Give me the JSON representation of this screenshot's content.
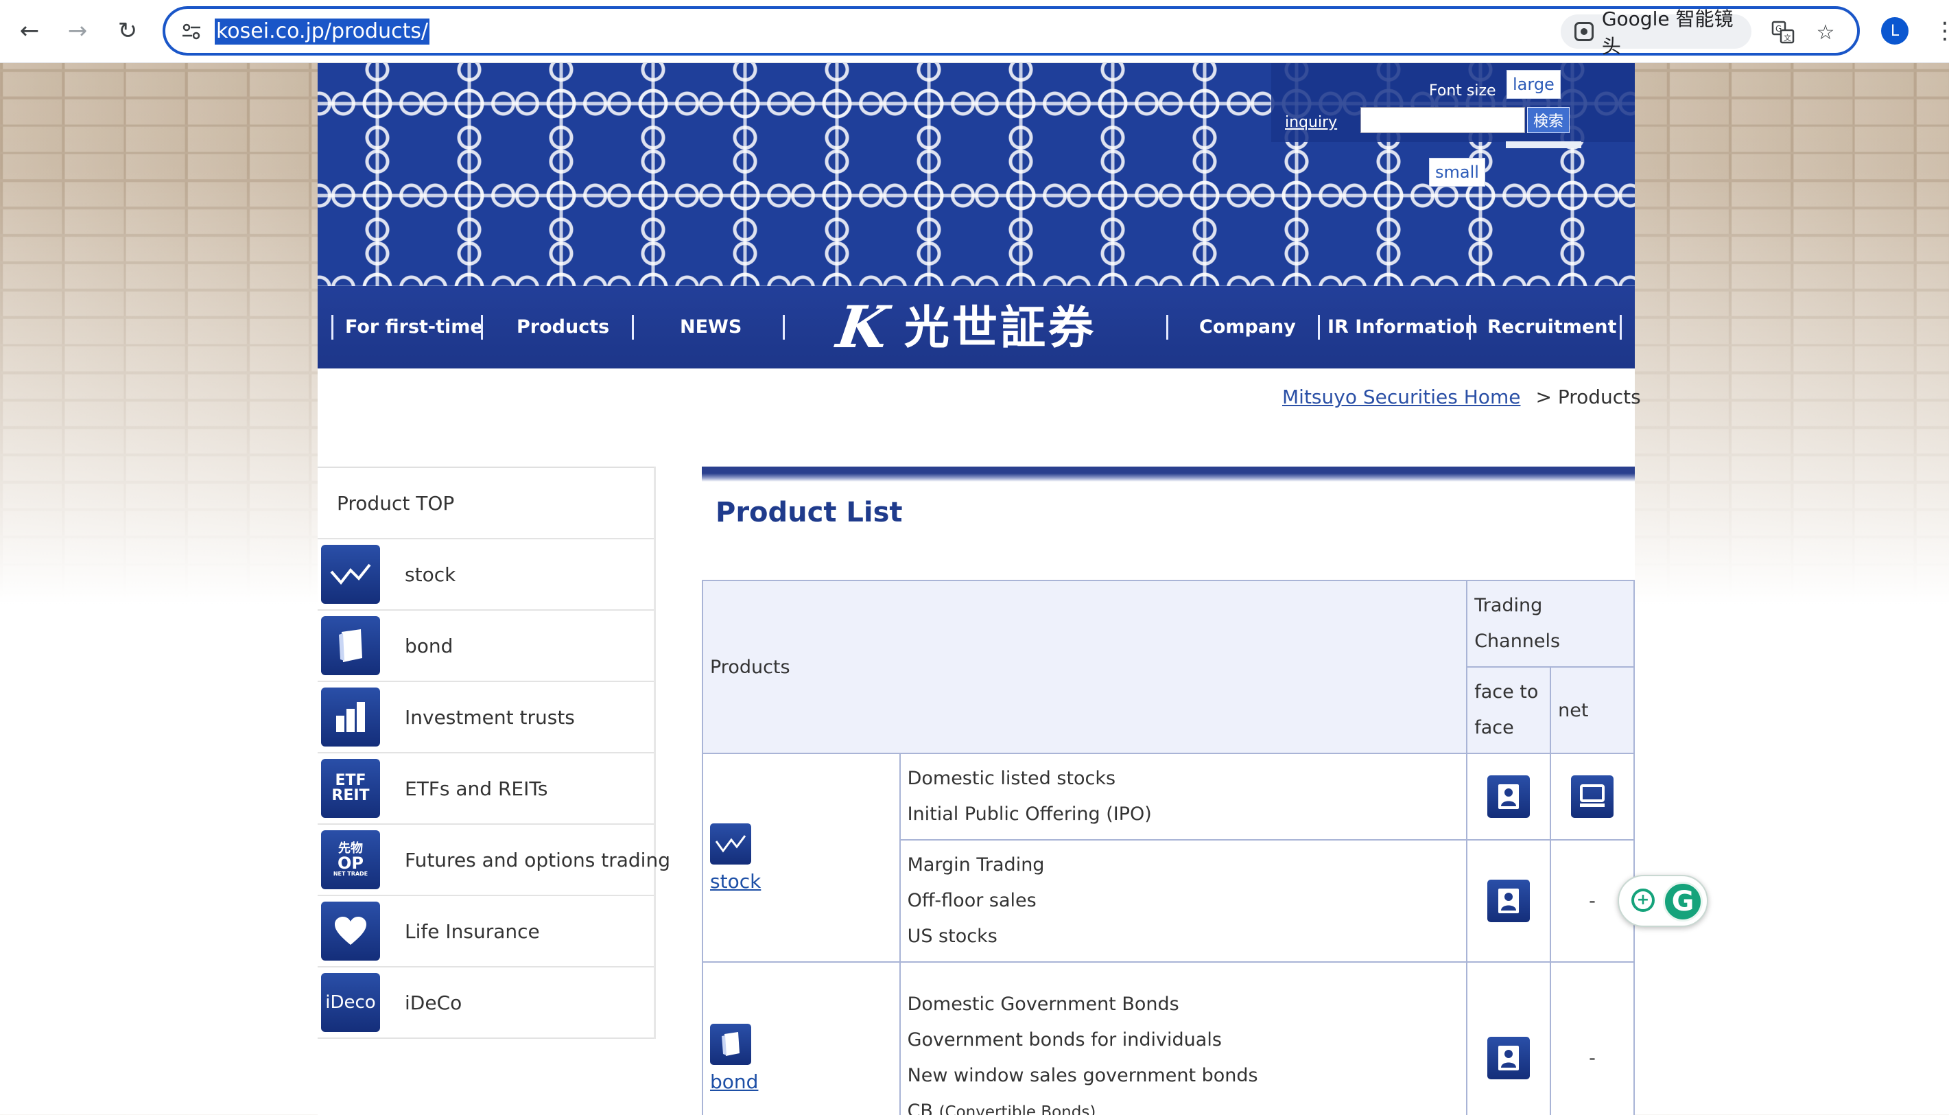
{
  "browser": {
    "url": "kosei.co.jp/products/",
    "lens_label": "Google 智能镜头",
    "avatar_letter": "L",
    "icons": {
      "back": "back-arrow-icon",
      "forward": "forward-arrow-icon",
      "reload": "reload-icon",
      "site_info": "site-info-icon",
      "translate": "translate-icon",
      "bookmark": "star-icon",
      "menu": "kebab-menu-icon"
    }
  },
  "header": {
    "font_size_label": "Font size",
    "font_large": "large",
    "font_small": "small",
    "inquiry": "inquiry",
    "search_button": "検索"
  },
  "nav": {
    "items": [
      "For first-time",
      "Products",
      "NEWS",
      "Company",
      "IR Information",
      "Recruitment"
    ],
    "logo_mark": "K",
    "logo_text": "光世証券"
  },
  "breadcrumb": {
    "home": "Mitsuyo Securities Home",
    "current": "> Products"
  },
  "sidebar": {
    "top": "Product TOP",
    "items": [
      {
        "label": "stock",
        "icon": "chart-line-icon"
      },
      {
        "label": "bond",
        "icon": "document-icon"
      },
      {
        "label": "Investment trusts",
        "icon": "bar-chart-icon"
      },
      {
        "label": "ETFs and REITs",
        "icon": "etf-reit-icon",
        "icon_text": [
          "ETF",
          "REIT"
        ]
      },
      {
        "label": "Futures and options trading",
        "icon": "futures-options-icon",
        "icon_text": [
          "先物",
          "OP",
          "NET TRADE"
        ]
      },
      {
        "label": "Life Insurance",
        "icon": "heart-icon"
      },
      {
        "label": "iDeCo",
        "icon": "ideco-icon",
        "icon_text": [
          "iDeco"
        ]
      }
    ]
  },
  "main": {
    "title": "Product List",
    "table": {
      "head_products": "Products",
      "head_channels": "Trading Channels",
      "head_face": "face to face",
      "head_net": "net",
      "stock": {
        "category": "stock",
        "row1": [
          "Domestic listed stocks",
          "Initial Public Offering (IPO)"
        ],
        "row2": [
          "Margin Trading",
          "Off-floor sales",
          "US stocks"
        ],
        "row2_net": "-"
      },
      "bond": {
        "category": "bond",
        "lines": [
          "Domestic Government Bonds",
          "Government bonds for individuals",
          "New window sales government bonds"
        ],
        "cb": "CB",
        "cb_note": "(Convertible Bonds)",
        "net": "-"
      }
    }
  },
  "colors": {
    "brand_navy": "#1f3f9a",
    "link_blue": "#2b50a6",
    "title_blue": "#1f3b8c",
    "table_border": "#a9b4d6",
    "omnibox_focus": "#1a56c8",
    "grammarly_green": "#15a37b"
  }
}
